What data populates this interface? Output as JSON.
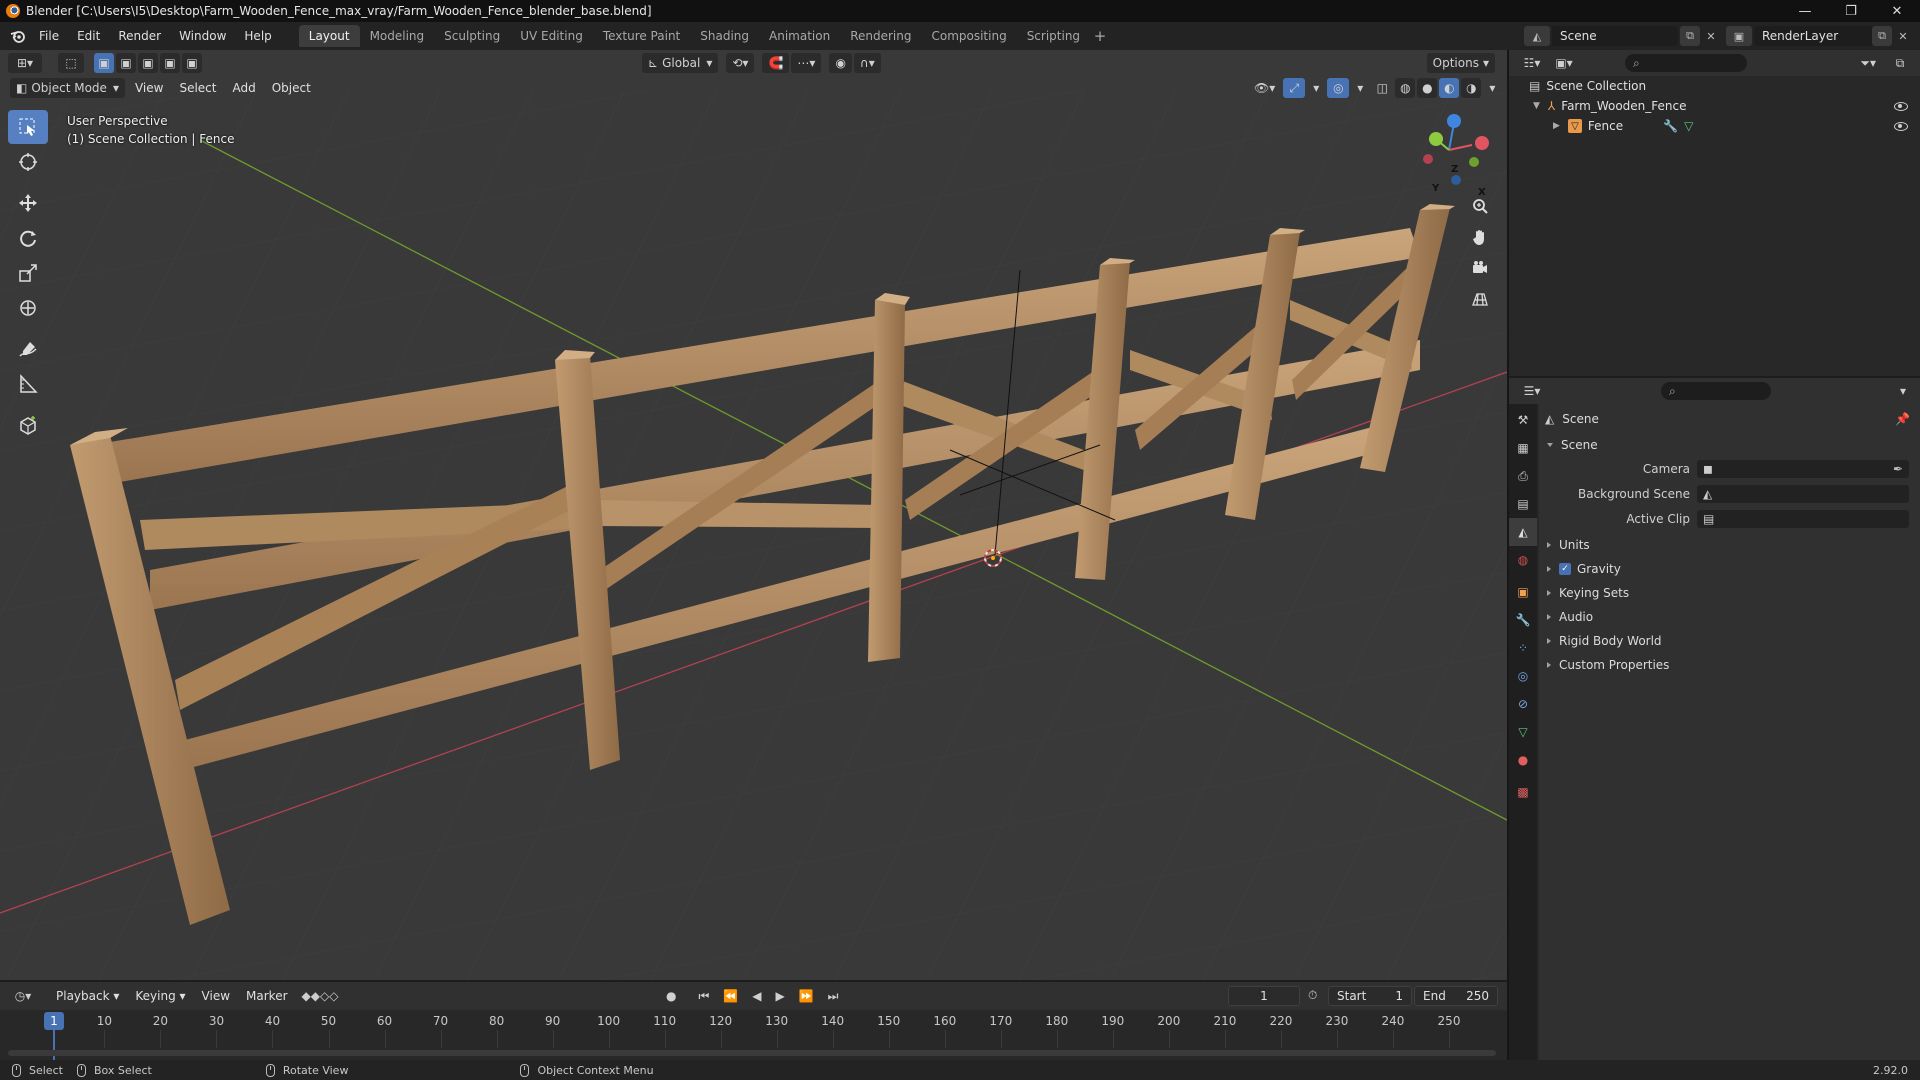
{
  "window": {
    "title": "Blender [C:\\Users\\I5\\Desktop\\Farm_Wooden_Fence_max_vray/Farm_Wooden_Fence_blender_base.blend]",
    "minimize": "—",
    "maximize": "❐",
    "close": "✕"
  },
  "menu": [
    "File",
    "Edit",
    "Render",
    "Window",
    "Help"
  ],
  "workspaces": [
    {
      "label": "Layout",
      "active": true
    },
    {
      "label": "Modeling"
    },
    {
      "label": "Sculpting"
    },
    {
      "label": "UV Editing"
    },
    {
      "label": "Texture Paint"
    },
    {
      "label": "Shading"
    },
    {
      "label": "Animation"
    },
    {
      "label": "Rendering"
    },
    {
      "label": "Compositing"
    },
    {
      "label": "Scripting"
    }
  ],
  "workspace_add": "+",
  "scene_selector": {
    "value": "Scene"
  },
  "viewlayer_selector": {
    "value": "RenderLayer"
  },
  "viewport_header": {
    "transform_orientation": "Global",
    "options": "Options",
    "mode": "Object Mode",
    "menus": [
      "View",
      "Select",
      "Add",
      "Object"
    ]
  },
  "viewport_info": {
    "line1": "User Perspective",
    "line2": "(1) Scene Collection | Fence"
  },
  "gizmo": {
    "x": "X",
    "y": "Y",
    "z": "Z"
  },
  "outliner": {
    "root": "Scene Collection",
    "collection": "Farm_Wooden_Fence",
    "object": "Fence"
  },
  "properties": {
    "context": "Scene",
    "panel": "Scene",
    "fields": [
      {
        "label": "Camera"
      },
      {
        "label": "Background Scene"
      },
      {
        "label": "Active Clip"
      }
    ],
    "sections": [
      "Units",
      "Gravity",
      "Keying Sets",
      "Audio",
      "Rigid Body World",
      "Custom Properties"
    ],
    "gravity_checked": true
  },
  "timeline": {
    "menus": [
      "Playback",
      "Keying",
      "View",
      "Marker"
    ],
    "current_frame": "1",
    "start_label": "Start",
    "start": "1",
    "end_label": "End",
    "end": "250",
    "ticks": [
      "1",
      "10",
      "20",
      "30",
      "40",
      "50",
      "60",
      "70",
      "80",
      "90",
      "100",
      "110",
      "120",
      "130",
      "140",
      "150",
      "160",
      "170",
      "180",
      "190",
      "200",
      "210",
      "220",
      "230",
      "240",
      "250"
    ]
  },
  "statusbar": {
    "select": "Select",
    "box_select": "Box Select",
    "rotate_view": "Rotate View",
    "context_menu": "Object Context Menu",
    "version": "2.92.0"
  },
  "colors": {
    "accent": "#4772b3",
    "x_axis": "#e05562",
    "y_axis": "#8dcc3f",
    "z_axis": "#3f86e0",
    "wood": "#b58f65"
  }
}
